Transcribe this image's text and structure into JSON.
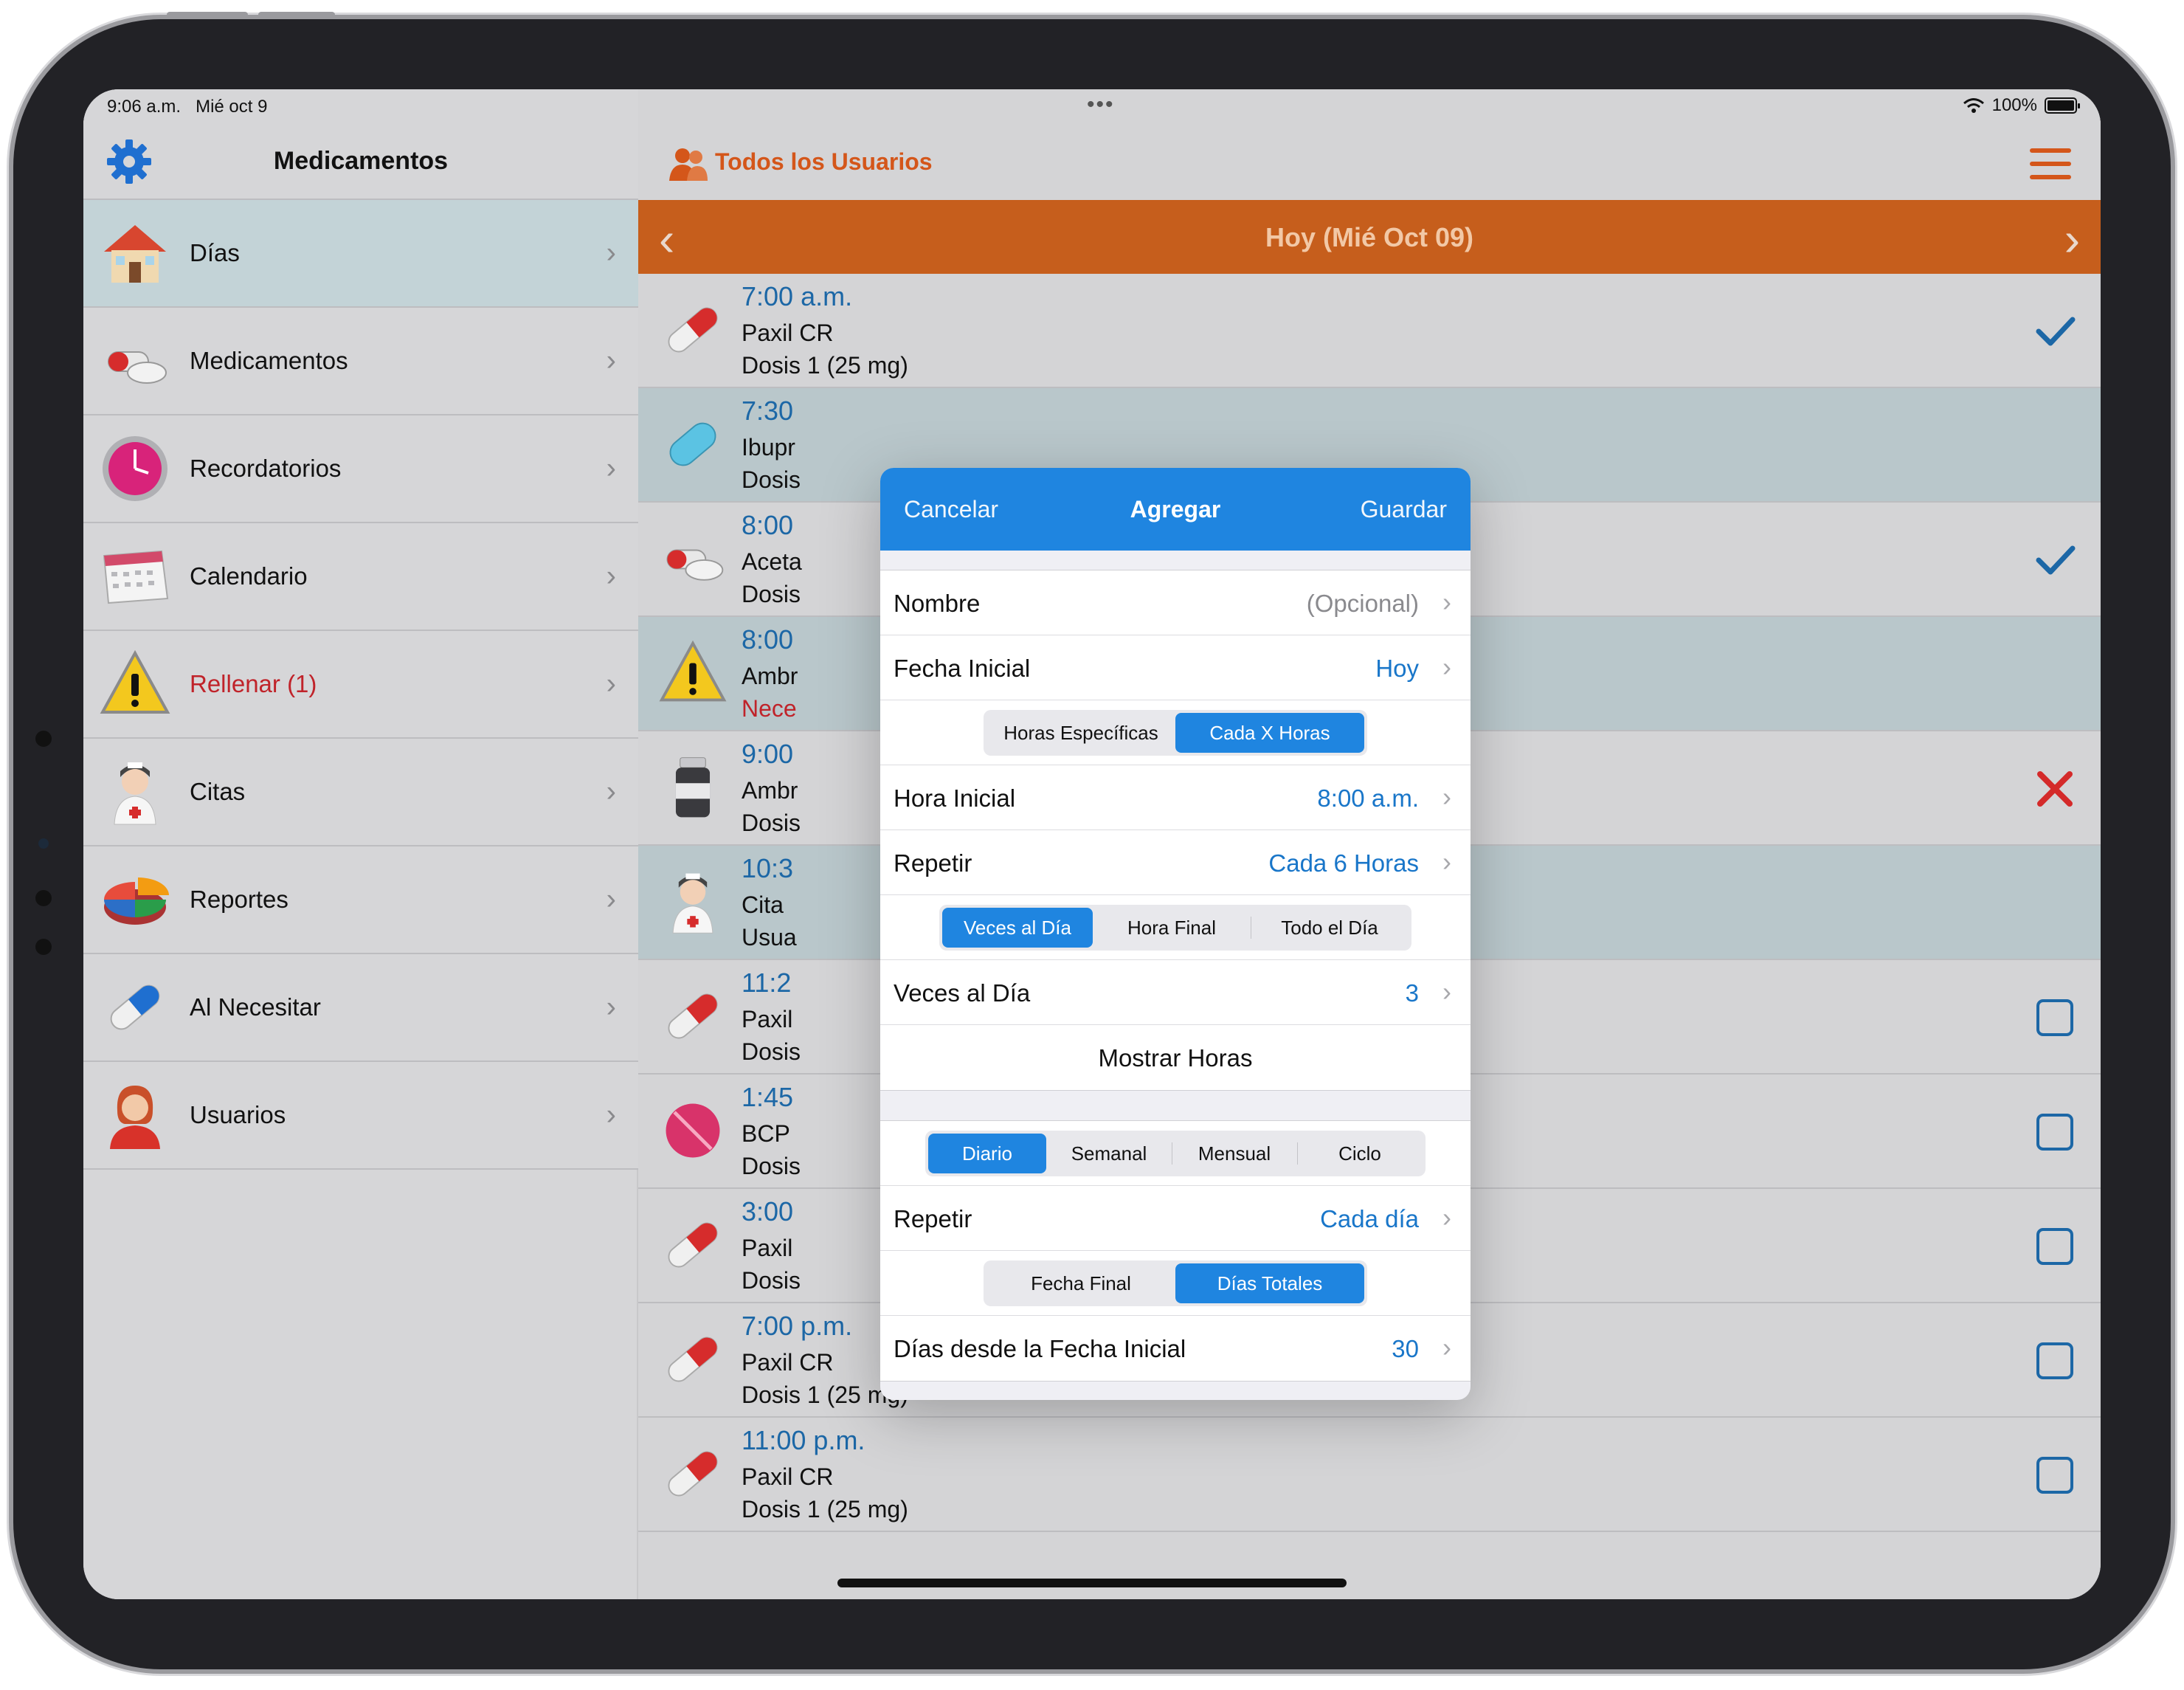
{
  "status": {
    "time": "9:06 a.m.",
    "date": "Mié oct 9",
    "battery": "100%",
    "battery_level": 1.0
  },
  "sidebar": {
    "title": "Medicamentos",
    "items": [
      {
        "label": "Días",
        "icon": "house-icon"
      },
      {
        "label": "Medicamentos",
        "icon": "pills-icon"
      },
      {
        "label": "Recordatorios",
        "icon": "clock-icon"
      },
      {
        "label": "Calendario",
        "icon": "calendar-icon"
      },
      {
        "label": "Rellenar (1)",
        "icon": "warning-icon"
      },
      {
        "label": "Citas",
        "icon": "nurse-icon"
      },
      {
        "label": "Reportes",
        "icon": "pie-chart-icon"
      },
      {
        "label": "Al Necesitar",
        "icon": "capsule-blue-icon"
      },
      {
        "label": "Usuarios",
        "icon": "user-icon"
      }
    ]
  },
  "header": {
    "users_label": "Todos los Usuarios",
    "day_label": "Hoy (Mié Oct 09)"
  },
  "schedule": [
    {
      "time": "7:00 a.m.",
      "name": "Paxil CR",
      "detail": "Dosis 1 (25 mg)",
      "status": "check"
    },
    {
      "time": "7:30",
      "name": "Ibupr",
      "detail": "Dosis",
      "status": ""
    },
    {
      "time": "8:00",
      "name": "Aceta",
      "detail": "Dosis",
      "status": "check"
    },
    {
      "time": "8:00",
      "name": "Ambr",
      "detail": "Nece",
      "status": ""
    },
    {
      "time": "9:00",
      "name": "Ambr",
      "detail": "Dosis",
      "status": "x"
    },
    {
      "time": "10:3",
      "name": "Cita",
      "detail": "Usua",
      "status": ""
    },
    {
      "time": "11:2",
      "name": "Paxil",
      "detail": "Dosis",
      "status": "box"
    },
    {
      "time": "1:45",
      "name": "BCP",
      "detail": "Dosis",
      "status": "box"
    },
    {
      "time": "3:00",
      "name": "Paxil",
      "detail": "Dosis",
      "status": "box"
    },
    {
      "time": "7:00 p.m.",
      "name": "Paxil CR",
      "detail": "Dosis 1 (25 mg)",
      "status": "box"
    },
    {
      "time": "11:00 p.m.",
      "name": "Paxil CR",
      "detail": "Dosis 1 (25 mg)",
      "status": "box"
    }
  ],
  "modal": {
    "cancel": "Cancelar",
    "title": "Agregar",
    "save": "Guardar",
    "nombre_label": "Nombre",
    "nombre_placeholder": "(Opcional)",
    "fecha_label": "Fecha Inicial",
    "fecha_value": "Hoy",
    "seg1": [
      "Horas Específicas",
      "Cada X Horas"
    ],
    "hora_label": "Hora Inicial",
    "hora_value": "8:00 a.m.",
    "repetir_label": "Repetir",
    "repetir_value": "Cada 6 Horas",
    "seg2": [
      "Veces al Día",
      "Hora Final",
      "Todo el Día"
    ],
    "veces_label": "Veces al Día",
    "veces_value": "3",
    "mostrar_label": "Mostrar Horas",
    "seg3": [
      "Diario",
      "Semanal",
      "Mensual",
      "Ciclo"
    ],
    "repetir2_label": "Repetir",
    "repetir2_value": "Cada día",
    "seg4": [
      "Fecha Final",
      "Días Totales"
    ],
    "dias_label": "Días desde la Fecha Inicial",
    "dias_value": "30"
  },
  "colors": {
    "accent_orange": "#c65e1c",
    "accent_blue": "#1f85e0",
    "link_blue": "#1976c9",
    "alert_red": "#c0232a"
  }
}
